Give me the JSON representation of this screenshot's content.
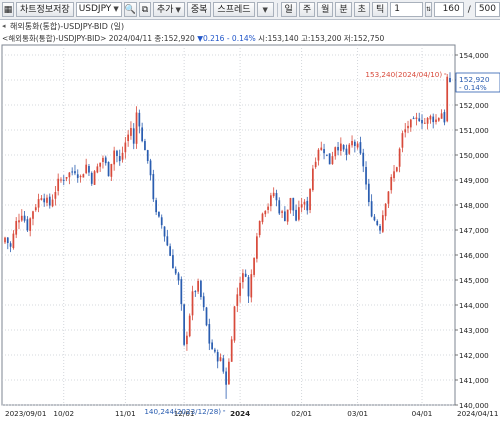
{
  "toolbar": {
    "save_chart_label": "차트정보저장",
    "symbol_value": "USDJPY",
    "add_label": "추가",
    "overlay_label": "중복",
    "spread_label": "스프레드",
    "periods": [
      "일",
      "주",
      "월",
      "분",
      "초",
      "틱"
    ],
    "interval_value": "1",
    "count_value": "160",
    "total_value": "500",
    "slash": "/"
  },
  "chart_header": {
    "title": "해외통화(통합)-USDJPY-BID (일)",
    "info_prefix": "<해외통화(통합)-USDJPY-BID> 2024/04/11 종:152,920 ",
    "change": "▼0.216 - 0.14%",
    "info_suffix": " 시:153,140 고:153,200 저:152,750"
  },
  "annotations": {
    "high_label": "153,240(2024/04/10)",
    "low_label": "140,244(2023/12/28)",
    "last_price": "152,920",
    "last_change": "- 0.14%"
  },
  "colors": {
    "up": "#d84a3b",
    "down": "#2a5db0",
    "grid": "#c8ccd2",
    "last_price_box": "#2a5db0"
  },
  "chart_data": {
    "type": "candlestick",
    "title": "해외통화(통합)-USDJPY-BID (일)",
    "ylim": [
      140,
      154.4
    ],
    "y_ticks": [
      "154,000",
      "153,000",
      "152,000",
      "151,000",
      "150,000",
      "149,000",
      "148,000",
      "147,000",
      "146,000",
      "145,000",
      "144,000",
      "143,000",
      "142,000",
      "141,000",
      "140,000"
    ],
    "x_ticks": [
      "2023/09/01",
      "10/02",
      "11/01",
      "12/01",
      "2024",
      "02/01",
      "03/01",
      "04/01",
      "2024/04/11"
    ],
    "close_path": [
      [
        0,
        146.7
      ],
      [
        2,
        146.3
      ],
      [
        4,
        147.3
      ],
      [
        6,
        147.7
      ],
      [
        8,
        147.1
      ],
      [
        10,
        147.8
      ],
      [
        13,
        148.4
      ],
      [
        16,
        148.0
      ],
      [
        19,
        148.9
      ],
      [
        22,
        149.2
      ],
      [
        25,
        149.4
      ],
      [
        27,
        149.1
      ],
      [
        29,
        149.6
      ],
      [
        31,
        149.0
      ],
      [
        33,
        149.5
      ],
      [
        35,
        149.9
      ],
      [
        37,
        149.3
      ],
      [
        39,
        150.2
      ],
      [
        41,
        149.7
      ],
      [
        43,
        150.5
      ],
      [
        45,
        151.1
      ],
      [
        46,
        150.4
      ],
      [
        47,
        151.7
      ],
      [
        48,
        151.3
      ],
      [
        49,
        150.5
      ],
      [
        50,
        150.3
      ],
      [
        51,
        149.6
      ],
      [
        52,
        149.3
      ],
      [
        53,
        148.3
      ],
      [
        54,
        147.6
      ],
      [
        56,
        147.2
      ],
      [
        58,
        146.4
      ],
      [
        60,
        145.6
      ],
      [
        62,
        144.9
      ],
      [
        63,
        143.9
      ],
      [
        64,
        142.3
      ],
      [
        65,
        142.9
      ],
      [
        67,
        144.4
      ],
      [
        69,
        144.8
      ],
      [
        71,
        143.8
      ],
      [
        73,
        142.5
      ],
      [
        75,
        142.0
      ],
      [
        77,
        141.8
      ],
      [
        79,
        140.9
      ],
      [
        80,
        141.7
      ],
      [
        82,
        143.9
      ],
      [
        84,
        145.0
      ],
      [
        86,
        145.3
      ],
      [
        87,
        144.3
      ],
      [
        88,
        145.2
      ],
      [
        90,
        146.9
      ],
      [
        92,
        147.8
      ],
      [
        94,
        148.0
      ],
      [
        96,
        148.5
      ],
      [
        98,
        147.8
      ],
      [
        100,
        147.5
      ],
      [
        102,
        148.2
      ],
      [
        104,
        147.4
      ],
      [
        106,
        148.1
      ],
      [
        108,
        147.9
      ],
      [
        110,
        149.5
      ],
      [
        112,
        150.3
      ],
      [
        114,
        150.2
      ],
      [
        116,
        149.7
      ],
      [
        118,
        150.4
      ],
      [
        120,
        150.3
      ],
      [
        122,
        150.0
      ],
      [
        124,
        150.5
      ],
      [
        126,
        150.3
      ],
      [
        128,
        149.6
      ],
      [
        130,
        148.0
      ],
      [
        132,
        147.4
      ],
      [
        134,
        147.1
      ],
      [
        136,
        148.2
      ],
      [
        138,
        149.0
      ],
      [
        140,
        149.6
      ],
      [
        142,
        150.8
      ],
      [
        144,
        151.2
      ],
      [
        146,
        151.3
      ],
      [
        148,
        151.5
      ],
      [
        150,
        151.3
      ],
      [
        152,
        151.5
      ],
      [
        154,
        151.4
      ],
      [
        156,
        151.7
      ],
      [
        157,
        151.4
      ],
      [
        158,
        153.1
      ],
      [
        159,
        152.9
      ]
    ],
    "last_close": 152.92,
    "period_high": 153.24,
    "period_low": 140.244
  }
}
